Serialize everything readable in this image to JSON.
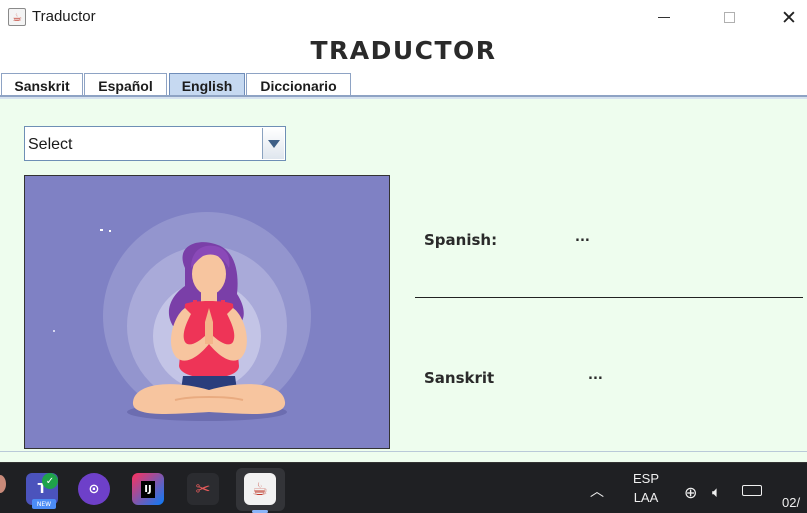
{
  "window": {
    "title": "Traductor",
    "app_icon": "java-icon",
    "controls": {
      "minimize": "minimize-icon",
      "maximize": "maximize-icon",
      "close": "✕"
    }
  },
  "header": {
    "title": "TRADUCTOR"
  },
  "tabs": [
    {
      "label": "Sanskrit",
      "active": false
    },
    {
      "label": "Español",
      "active": false
    },
    {
      "label": "English",
      "active": true
    },
    {
      "label": "Diccionario",
      "active": false
    }
  ],
  "main": {
    "select": {
      "value": "Select"
    },
    "image": {
      "subject": "yoga-meditation-woman-illustration",
      "background_color": "#7f81c4"
    },
    "translations": [
      {
        "label": "Spanish:",
        "value": "..."
      },
      {
        "label": "Sanskrit",
        "value": "..."
      }
    ]
  },
  "taskbar": {
    "apps": [
      "teams-icon",
      "github-icon",
      "intellij-icon",
      "snipping-tool-icon",
      "java-icon"
    ],
    "tray": {
      "language_top": "ESP",
      "language_bottom": "LAA",
      "clock_partial": "02/"
    }
  },
  "colors": {
    "panel_bg": "#eefdee",
    "tab_active": "#c6d9f1",
    "image_bg": "#7f81c4"
  }
}
